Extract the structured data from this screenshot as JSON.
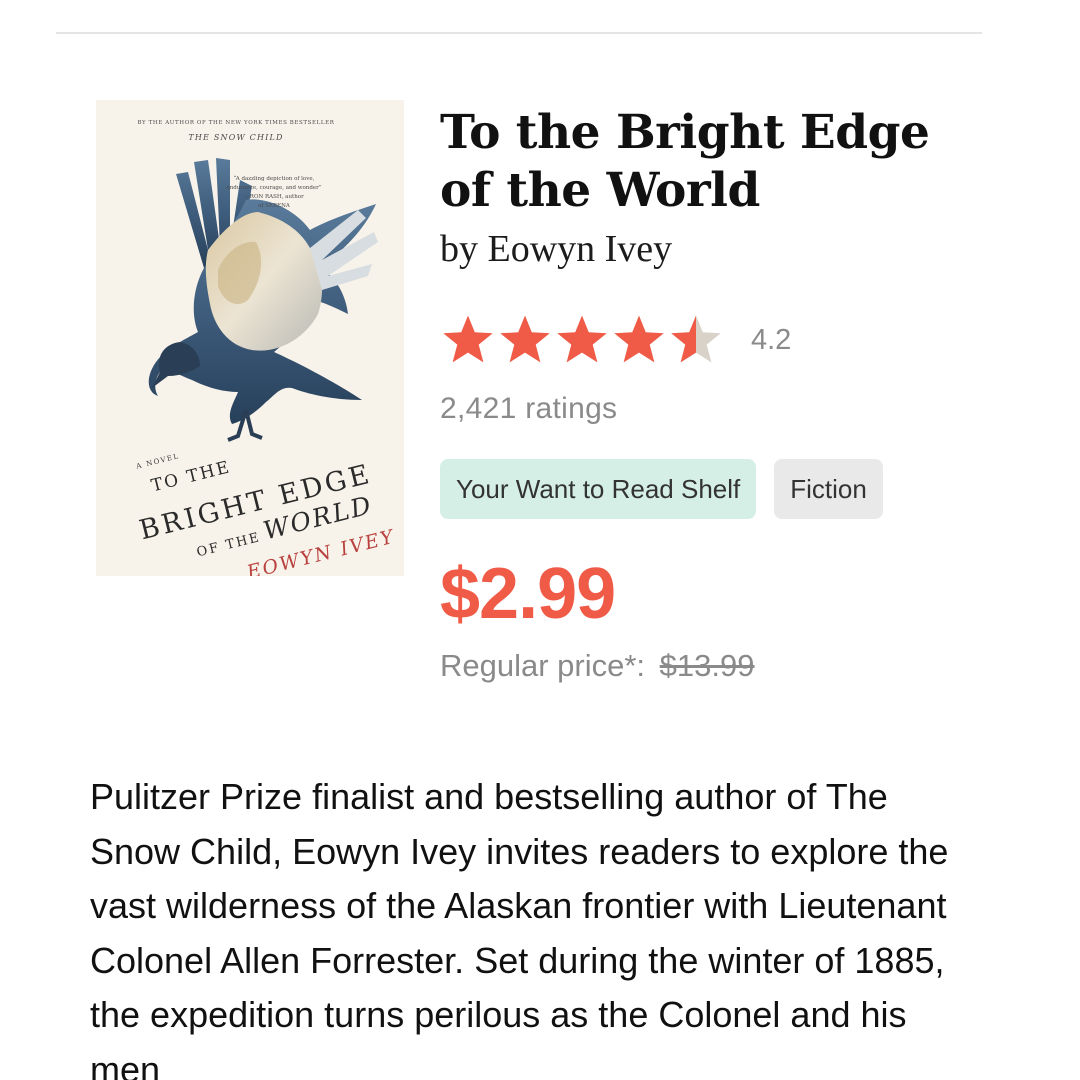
{
  "book": {
    "title": "To the Bright Edge of the World",
    "author_prefix": "by",
    "author": "Eowyn Ivey",
    "rating": "4.2",
    "rating_fraction": 0.84,
    "ratings_count": "2,421 ratings",
    "shelf_label": "Your Want to Read Shelf",
    "genre_label": "Fiction",
    "sale_price": "$2.99",
    "regular_price_label": "Regular price*:",
    "regular_price": "$13.99",
    "description": "Pulitzer Prize finalist and bestselling author of The Snow Child, Eowyn Ivey invites readers to explore the vast wilderness of the Alaskan frontier with Lieutenant Colonel Allen Forrester. Set during the winter of 1885, the expedition turns perilous as the Colonel and his men"
  },
  "cover": {
    "top_line": "BY THE AUTHOR OF THE NEW YORK TIMES BESTSELLER",
    "top_title": "THE SNOW CHILD",
    "blurb_line1": "“A dazzling depiction of love,",
    "blurb_line2": "endurance, courage, and wonder”",
    "blurb_line3": "—RON RASH, author",
    "blurb_line4": "of SERENA",
    "novel": "A NOVEL",
    "title_line1": "TO THE",
    "title_line2": "BRIGHT EDGE",
    "title_line3a": "OF THE",
    "title_line3b": "WORLD",
    "author": "EOWYN IVEY"
  },
  "colors": {
    "accent": "#f05b47",
    "star_filled": "#f05b47",
    "star_empty": "#d8d2c8",
    "shelf_chip": "#d5efe6",
    "genre_chip": "#e9e9e9",
    "muted_text": "#8a8a8a"
  },
  "icons": {
    "star": "star-icon"
  }
}
